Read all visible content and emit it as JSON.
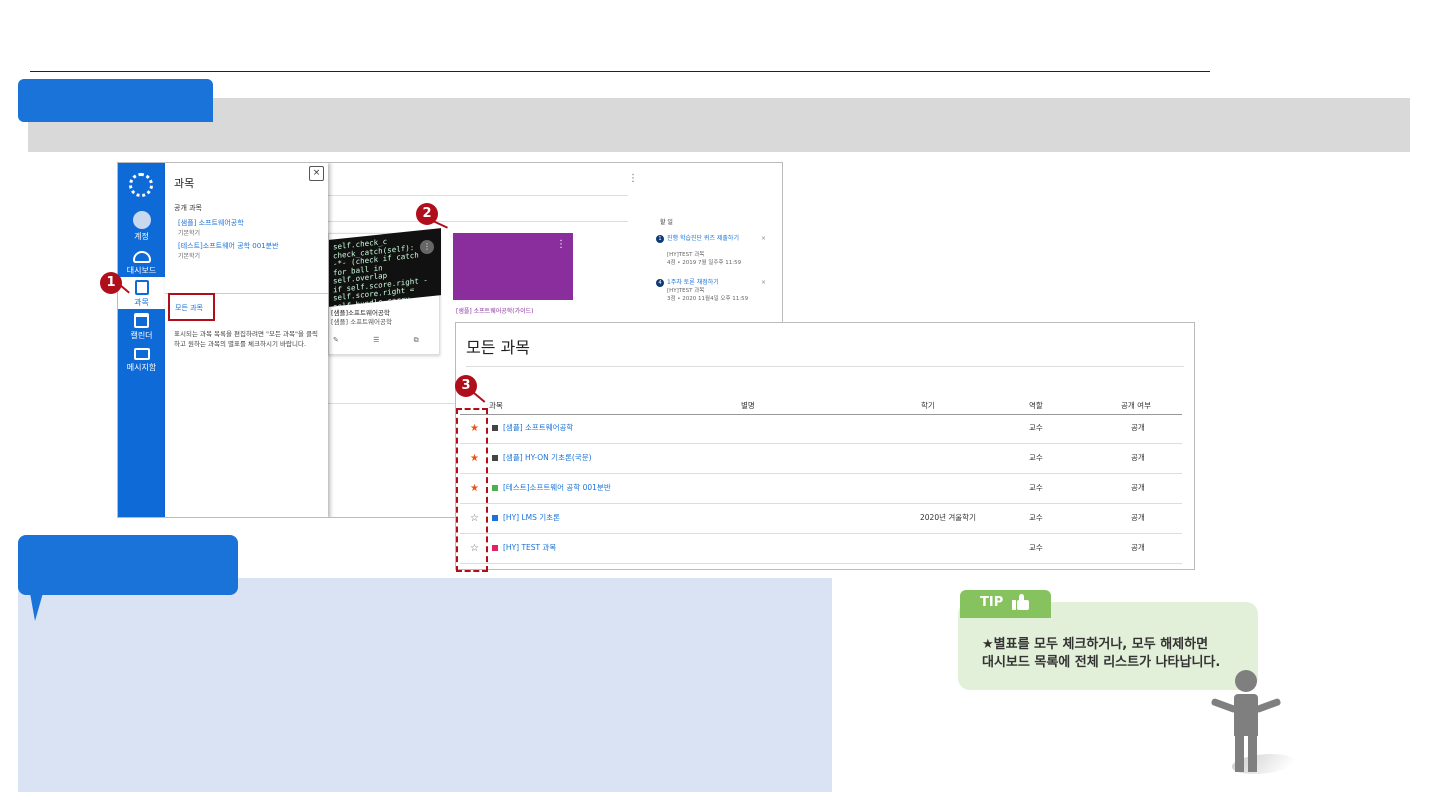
{
  "tray": {
    "title": "과목",
    "close": "×",
    "subtitle": "공개 과목",
    "courses": [
      {
        "name": "[샘플] 소프트웨어공학",
        "term": "기본학기"
      },
      {
        "name": "[테스트]소프트웨어 공학 001분반",
        "term": "기본학기"
      }
    ],
    "all_courses": "모든 과목",
    "description": "표시되는 과목 목록을 편집하려면 \"모든 과목\"을 클릭하고 원하는 과목의 별표를 체크하시기 바랍니다."
  },
  "nav": {
    "items": [
      {
        "label": "계정"
      },
      {
        "label": "대시보드"
      },
      {
        "label": "과목"
      },
      {
        "label": "캘린더"
      },
      {
        "label": "메시지함"
      }
    ]
  },
  "dashboard": {
    "card1_title": "[샘플]소프트웨어공학",
    "card1_sub": "[샘플] 소프트웨어공학",
    "card1_icons": "✎ ☰ ⧉",
    "card2_title": "[샘플] 소프트웨어공학(가이드)",
    "code_lines": [
      "self.check_c",
      "check_catch(self):",
      "-*- (check if catch",
      "for ball in self.overlap",
      "  if self.score.right -",
      "   self.score.right =",
      "   self.bundle.carry"
    ],
    "todo_title": "할 일",
    "todos": [
      {
        "num": "1",
        "link": "진행 학습진단 퀴즈 제출하기",
        "course": "[HY]TEST 과목",
        "meta": "4점 • 2019 7월 일주후 11:59"
      },
      {
        "num": "4",
        "link": "1주차 토론 채점하기",
        "course": "[HY]TEST 과목",
        "meta": "3점 • 2020 11월4일 오후 11:59"
      }
    ]
  },
  "markers": [
    "1",
    "2",
    "3"
  ],
  "all_courses": {
    "title": "모든 과목",
    "headers": [
      "과목",
      "별명",
      "학기",
      "역할",
      "공개 여부"
    ],
    "rows": [
      {
        "starred": true,
        "star": "★",
        "color": "#444444",
        "name": "[샘플] 소프트웨어공학",
        "nickname": "",
        "term": "",
        "role": "교수",
        "published": "공개"
      },
      {
        "starred": true,
        "star": "★",
        "color": "#444444",
        "name": "[샘플] HY-ON 기초론(국문)",
        "nickname": "",
        "term": "",
        "role": "교수",
        "published": "공개"
      },
      {
        "starred": true,
        "star": "★",
        "color": "#4caf50",
        "name": "[테스트]소프트웨어 공학 001분반",
        "nickname": "",
        "term": "",
        "role": "교수",
        "published": "공개"
      },
      {
        "starred": false,
        "star": "☆",
        "color": "#1a73d9",
        "name": "[HY] LMS 기초론",
        "nickname": "",
        "term": "2020년 겨울학기",
        "role": "교수",
        "published": "공개"
      },
      {
        "starred": false,
        "star": "☆",
        "color": "#e91e63",
        "name": "[HY] TEST 과목",
        "nickname": "",
        "term": "",
        "role": "교수",
        "published": "공개"
      }
    ]
  },
  "tip": {
    "label": "TIP",
    "line1": "★별표를 모두 체크하거나, 모두 해제하면",
    "line2": "대시보드 목록에 전체 리스트가 나타납니다."
  },
  "colors": {
    "accent": "#1a73d9",
    "marker": "#b00e1b",
    "tip_green": "#86c25e",
    "star_on": "#e8541c"
  }
}
